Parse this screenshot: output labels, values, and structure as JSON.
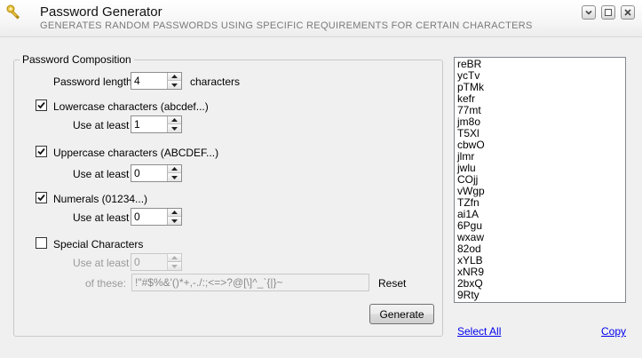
{
  "window": {
    "title": "Password Generator",
    "subtitle": "GENERATES RANDOM PASSWORDS USING SPECIFIC REQUIREMENTS FOR CERTAIN CHARACTERS"
  },
  "composition": {
    "legend": "Password Composition",
    "length_label": "Password length",
    "length_value": "4",
    "length_unit": "characters",
    "lowercase": {
      "label": "Lowercase characters (abcdef...)",
      "checked": true,
      "use_at_least_label": "Use at least",
      "value": "1"
    },
    "uppercase": {
      "label": "Uppercase characters (ABCDEF...)",
      "checked": true,
      "use_at_least_label": "Use at least",
      "value": "0"
    },
    "numerals": {
      "label": "Numerals (01234...)",
      "checked": true,
      "use_at_least_label": "Use at least",
      "value": "0"
    },
    "special": {
      "label": "Special Characters",
      "checked": false,
      "use_at_least_label": "Use at least",
      "value": "0",
      "of_these_label": "of these:",
      "characters": "!\"#$%&'()*+,-./:;<=>?@[\\]^_`{|}~",
      "reset_label": "Reset"
    },
    "generate_label": "Generate"
  },
  "passwords": [
    "reBR",
    "ycTv",
    "pTMk",
    "kefr",
    "77mt",
    "jm8o",
    "T5Xl",
    "cbwO",
    "jlmr",
    "jwlu",
    "COjj",
    "vWgp",
    "TZfn",
    "ai1A",
    "6Pgu",
    "wxaw",
    "82od",
    "xYLB",
    "xNR9",
    "2bxQ",
    "9Rty"
  ],
  "actions": {
    "select_all_label": "Select All",
    "copy_label": "Copy"
  },
  "colors": {
    "link": "#0000ee",
    "disabled_text": "#9a9a9a"
  }
}
